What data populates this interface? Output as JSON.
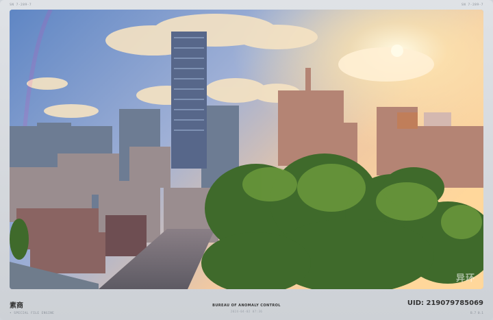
{
  "top": {
    "left_code": "SN  7-289-7",
    "right_code": "SN  7-289-7"
  },
  "viewport": {
    "scene_icon": "city-skyline-sunset-photo",
    "watermark": "异环"
  },
  "footer": {
    "left_label": "素商",
    "left_sublabel": "• SPECIAL FILE ENGINE",
    "center_title": "BUREAU OF ANOMALY CONTROL",
    "center_subtitle": "2024-04-02 07:36",
    "uid": "UID: 219079785069",
    "version": "B.7 0.1"
  }
}
